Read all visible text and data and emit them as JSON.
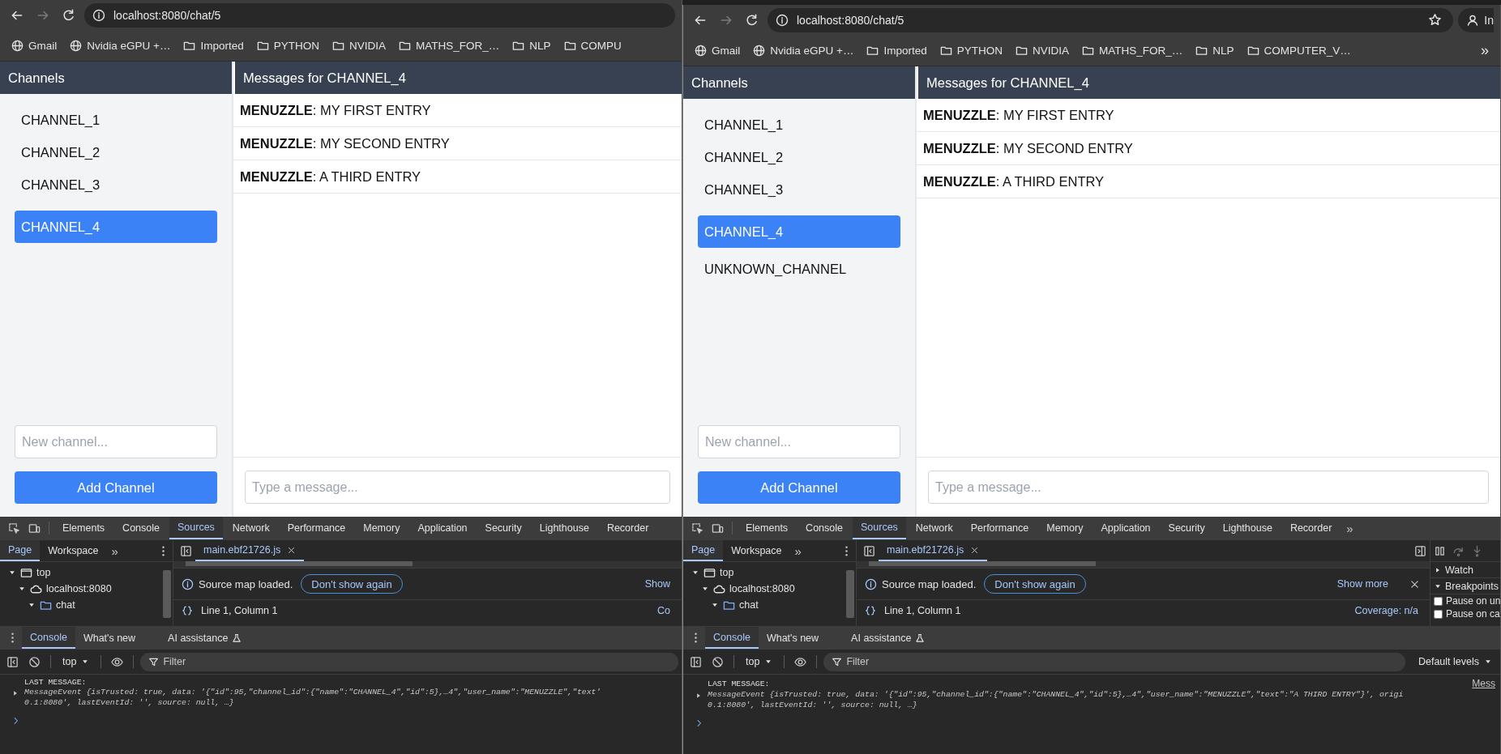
{
  "windows": [
    {
      "toolbar": {
        "nav": [
          {
            "kind": "back",
            "disabled": false
          },
          {
            "kind": "forward",
            "disabled": true
          },
          {
            "kind": "reload",
            "disabled": false
          }
        ],
        "url": "localhost:8080/chat/5"
      },
      "bookmarks": [
        {
          "kind": "globe",
          "label": "Gmail"
        },
        {
          "kind": "globe",
          "label": "Nvidia eGPU +…"
        },
        {
          "kind": "folder",
          "label": "Imported"
        },
        {
          "kind": "folder",
          "label": "PYTHON"
        },
        {
          "kind": "folder",
          "label": "NVIDIA"
        },
        {
          "kind": "folder",
          "label": "MATHS_FOR_…"
        },
        {
          "kind": "folder",
          "label": "NLP"
        },
        {
          "kind": "folder",
          "label": "COMPU"
        }
      ],
      "app": {
        "sidebar": {
          "title": "Channels",
          "channels": [
            {
              "name": "CHANNEL_1",
              "selected": false
            },
            {
              "name": "CHANNEL_2",
              "selected": false
            },
            {
              "name": "CHANNEL_3",
              "selected": false
            },
            {
              "name": "CHANNEL_4",
              "selected": true
            }
          ],
          "new_channel_placeholder": "New channel...",
          "add_button": "Add Channel"
        },
        "main": {
          "title": "Messages for CHANNEL_4",
          "messages": [
            {
              "text": "**MENUZZLE**: MY FIRST ENTRY"
            },
            {
              "text": "**MENUZZLE**: MY SECOND ENTRY"
            },
            {
              "text": "**MENUZZLE**: A THIRD ENTRY"
            }
          ],
          "input_placeholder": "Type a message..."
        }
      },
      "devtools": {
        "tabs": [
          {
            "label": "Elements",
            "selected": false
          },
          {
            "label": "Console",
            "selected": false
          },
          {
            "label": "Sources",
            "selected": true
          },
          {
            "label": "Network",
            "selected": false
          },
          {
            "label": "Performance",
            "selected": false
          },
          {
            "label": "Memory",
            "selected": false
          },
          {
            "label": "Application",
            "selected": false
          },
          {
            "label": "Security",
            "selected": false
          },
          {
            "label": "Lighthouse",
            "selected": false
          },
          {
            "label": "Recorder",
            "selected": false
          }
        ],
        "navigator": {
          "tabs": [
            {
              "label": "Page",
              "selected": true
            },
            {
              "label": "Workspace",
              "selected": false
            }
          ],
          "overflow": "»",
          "tree": [
            {
              "kind": "frame",
              "label": "top",
              "expanded": true,
              "children": [
                {
                  "kind": "origin",
                  "label": "localhost:8080",
                  "expanded": true,
                  "children": [
                    {
                      "kind": "folder",
                      "label": "chat",
                      "expanded": true
                    }
                  ]
                }
              ]
            }
          ]
        },
        "file_tab": "main.ebf21726.js",
        "info": {
          "text": "Source map loaded.",
          "button": "Don't show again",
          "link": "Show",
          "closable": false
        },
        "status": {
          "position": "Line 1, Column 1",
          "coverage": "Co"
        },
        "drawer_tabs": [
          {
            "label": "Console",
            "selected": true,
            "experimental": false
          },
          {
            "label": "What's new",
            "selected": false,
            "experimental": false
          },
          {
            "label": "AI assistance",
            "selected": false,
            "experimental": true
          }
        ],
        "console": {
          "context": "top",
          "filter_placeholder": "Filter",
          "log_label": "LAST MESSAGE:",
          "log_lines": [
            "MessageEvent {isTrusted: true, data: '{\"id\":95,\"channel_id\":{\"name\":\"CHANNEL_4\",\"id\":5},…4\",\"user_name\":\"MENUZZLE\",\"text'",
            "0.1:8080', lastEventId: '', source: null, …}"
          ]
        }
      }
    },
    {
      "toolbar": {
        "nav": [
          {
            "kind": "back",
            "disabled": false
          },
          {
            "kind": "forward",
            "disabled": true
          },
          {
            "kind": "reload",
            "disabled": false
          }
        ],
        "url": "localhost:8080/chat/5",
        "star": true,
        "profile_label": "In"
      },
      "bookmarks": [
        {
          "kind": "globe",
          "label": "Gmail"
        },
        {
          "kind": "globe",
          "label": "Nvidia eGPU +…"
        },
        {
          "kind": "folder",
          "label": "Imported"
        },
        {
          "kind": "folder",
          "label": "PYTHON"
        },
        {
          "kind": "folder",
          "label": "NVIDIA"
        },
        {
          "kind": "folder",
          "label": "MATHS_FOR_…"
        },
        {
          "kind": "folder",
          "label": "NLP"
        },
        {
          "kind": "folder",
          "label": "COMPUTER_V…"
        }
      ],
      "bookmarks_overflow": "»",
      "app": {
        "sidebar": {
          "title": "Channels",
          "channels": [
            {
              "name": "CHANNEL_1",
              "selected": false
            },
            {
              "name": "CHANNEL_2",
              "selected": false
            },
            {
              "name": "CHANNEL_3",
              "selected": false
            },
            {
              "name": "CHANNEL_4",
              "selected": true
            },
            {
              "name": "UNKNOWN_CHANNEL",
              "selected": false
            }
          ],
          "new_channel_placeholder": "New channel...",
          "add_button": "Add Channel"
        },
        "main": {
          "title": "Messages for CHANNEL_4",
          "messages": [
            {
              "text": "**MENUZZLE**: MY FIRST ENTRY"
            },
            {
              "text": "**MENUZZLE**: MY SECOND ENTRY"
            },
            {
              "text": "**MENUZZLE**: A THIRD ENTRY"
            }
          ],
          "input_placeholder": "Type a message..."
        }
      },
      "devtools": {
        "tabs": [
          {
            "label": "Elements",
            "selected": false
          },
          {
            "label": "Console",
            "selected": false
          },
          {
            "label": "Sources",
            "selected": true
          },
          {
            "label": "Network",
            "selected": false
          },
          {
            "label": "Performance",
            "selected": false
          },
          {
            "label": "Memory",
            "selected": false
          },
          {
            "label": "Application",
            "selected": false
          },
          {
            "label": "Security",
            "selected": false
          },
          {
            "label": "Lighthouse",
            "selected": false
          },
          {
            "label": "Recorder",
            "selected": false
          }
        ],
        "tabs_overflow": "»",
        "navigator": {
          "tabs": [
            {
              "label": "Page",
              "selected": true
            },
            {
              "label": "Workspace",
              "selected": false
            }
          ],
          "overflow": "»",
          "tree": [
            {
              "kind": "frame",
              "label": "top",
              "expanded": true,
              "children": [
                {
                  "kind": "origin",
                  "label": "localhost:8080",
                  "expanded": true,
                  "children": [
                    {
                      "kind": "folder",
                      "label": "chat",
                      "expanded": true
                    }
                  ]
                }
              ]
            }
          ]
        },
        "file_tab": "main.ebf21726.js",
        "info": {
          "text": "Source map loaded.",
          "button": "Don't show again",
          "link": "Show more",
          "closable": true
        },
        "status": {
          "position": "Line 1, Column 1",
          "coverage": "Coverage: n/a"
        },
        "debugger": {
          "sections": [
            {
              "label": "Watch",
              "expanded": false
            },
            {
              "label": "Breakpoints",
              "expanded": true
            }
          ],
          "options": [
            {
              "label": "Pause on un",
              "checked": false
            },
            {
              "label": "Pause on ca",
              "checked": false
            }
          ]
        },
        "drawer_tabs": [
          {
            "label": "Console",
            "selected": true,
            "experimental": false
          },
          {
            "label": "What's new",
            "selected": false,
            "experimental": false
          },
          {
            "label": "AI assistance",
            "selected": false,
            "experimental": true
          }
        ],
        "console": {
          "context": "top",
          "filter_placeholder": "Filter",
          "levels": "Default levels",
          "log_label": "LAST MESSAGE:",
          "source_link": "Mess",
          "log_lines": [
            "MessageEvent {isTrusted: true, data: '{\"id\":95,\"channel_id\":{\"name\":\"CHANNEL_4\",\"id\":5},…4\",\"user_name\":\"MENUZZLE\",\"text\":\"A THIRD ENTRY\"}', origi",
            "0.1:8080', lastEventId: '', source: null, …}"
          ]
        }
      }
    }
  ]
}
